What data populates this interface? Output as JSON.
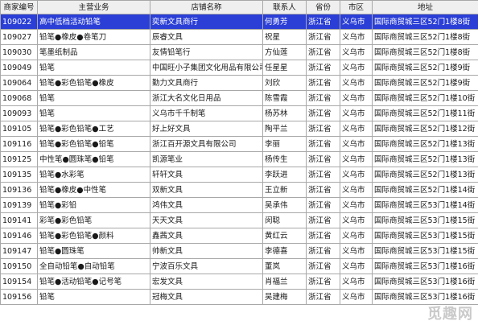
{
  "table": {
    "headers": [
      "商家编号",
      "主营业务",
      "店铺名称",
      "联系人",
      "省份",
      "市区",
      "地址"
    ],
    "rows": [
      {
        "id": "109022",
        "business": "高中低档活动铅笔",
        "shop": "奕新文具商行",
        "contact": "何勇芳",
        "province": "浙江省",
        "city": "义乌市",
        "address": "国际商贸城三区52门1楼8街",
        "highlighted": true
      },
      {
        "id": "109027",
        "business": "铅笔●橡皮●卷笔刀",
        "shop": "辰睿文具",
        "contact": "祝星",
        "province": "浙江省",
        "city": "义乌市",
        "address": "国际商贸城三区52门1楼8街"
      },
      {
        "id": "109030",
        "business": "笔墨纸制品",
        "shop": "友情铅笔行",
        "contact": "方仙莲",
        "province": "浙江省",
        "city": "义乌市",
        "address": "国际商贸城三区52门1楼8街"
      },
      {
        "id": "109049",
        "business": "铅笔",
        "shop": "中国旺小子集团文化用品有限公司",
        "contact": "任星星",
        "province": "浙江省",
        "city": "义乌市",
        "address": "国际商贸城三区52门1楼9街"
      },
      {
        "id": "109064",
        "business": "铅笔●彩色铅笔●橡皮",
        "shop": "勤力文具商行",
        "contact": "刘欣",
        "province": "浙江省",
        "city": "义乌市",
        "address": "国际商贸城三区52门1楼9街"
      },
      {
        "id": "109068",
        "business": "铅笔",
        "shop": "浙江大名文化日用品",
        "contact": "陈雪霞",
        "province": "浙江省",
        "city": "义乌市",
        "address": "国际商贸城三区52门1楼10街"
      },
      {
        "id": "109093",
        "business": "铅笔",
        "shop": "义乌市千千制笔",
        "contact": "杨苏林",
        "province": "浙江省",
        "city": "义乌市",
        "address": "国际商贸城三区52门1楼11街"
      },
      {
        "id": "109105",
        "business": "铅笔●彩色铅笔●工艺",
        "shop": "好上好文具",
        "contact": "陶平兰",
        "province": "浙江省",
        "city": "义乌市",
        "address": "国际商贸城三区52门1楼12街"
      },
      {
        "id": "109116",
        "business": "铅笔●彩色铅笔●铅笔",
        "shop": "浙江百开源文具有限公司",
        "contact": "李丽",
        "province": "浙江省",
        "city": "义乌市",
        "address": "国际商贸城三区52门1楼13街"
      },
      {
        "id": "109125",
        "business": "中性笔●圆珠笔●铅笔",
        "shop": "凯源笔业",
        "contact": "杨传生",
        "province": "浙江省",
        "city": "义乌市",
        "address": "国际商贸城三区52门1楼13街"
      },
      {
        "id": "109135",
        "business": "铅笔●水彩笔",
        "shop": "轩轩文具",
        "contact": "李跃进",
        "province": "浙江省",
        "city": "义乌市",
        "address": "国际商贸城三区52门1楼13街"
      },
      {
        "id": "109136",
        "business": "铅笔●橡皮●中性笔",
        "shop": "双新文具",
        "contact": "王立新",
        "province": "浙江省",
        "city": "义乌市",
        "address": "国际商贸城三区52门1楼14街"
      },
      {
        "id": "109139",
        "business": "铅笔●彩铅",
        "shop": "鸿伟文具",
        "contact": "吴承伟",
        "province": "浙江省",
        "city": "义乌市",
        "address": "国际商贸城三区53门1楼14街"
      },
      {
        "id": "109141",
        "business": "彩笔●彩色铅笔",
        "shop": "天天文具",
        "contact": "闵聪",
        "province": "浙江省",
        "city": "义乌市",
        "address": "国际商贸城三区53门1楼15街"
      },
      {
        "id": "109146",
        "business": "铅笔●彩色铅笔●颜料",
        "shop": "鑫茜文具",
        "contact": "黄红云",
        "province": "浙江省",
        "city": "义乌市",
        "address": "国际商贸城三区53门1楼15街"
      },
      {
        "id": "109147",
        "business": "铅笔●圆珠笔",
        "shop": "帅新文具",
        "contact": "李德喜",
        "province": "浙江省",
        "city": "义乌市",
        "address": "国际商贸城三区53门1楼15街"
      },
      {
        "id": "109150",
        "business": "全自动铅笔●自动铅笔",
        "shop": "宁波百乐文具",
        "contact": "董岚",
        "province": "浙江省",
        "city": "义乌市",
        "address": "国际商贸城三区53门1楼16街"
      },
      {
        "id": "109154",
        "business": "铅笔●活动铅笔●记号笔",
        "shop": "宏发文具",
        "contact": "肖福兰",
        "province": "浙江省",
        "city": "义乌市",
        "address": "国际商贸城三区53门1楼16街"
      },
      {
        "id": "109156",
        "business": "铅笔",
        "shop": "冠梅文具",
        "contact": "吴建梅",
        "province": "浙江省",
        "city": "义乌市",
        "address": "国际商贸城三区53门1楼16街"
      }
    ]
  },
  "watermark": "觅趣网"
}
